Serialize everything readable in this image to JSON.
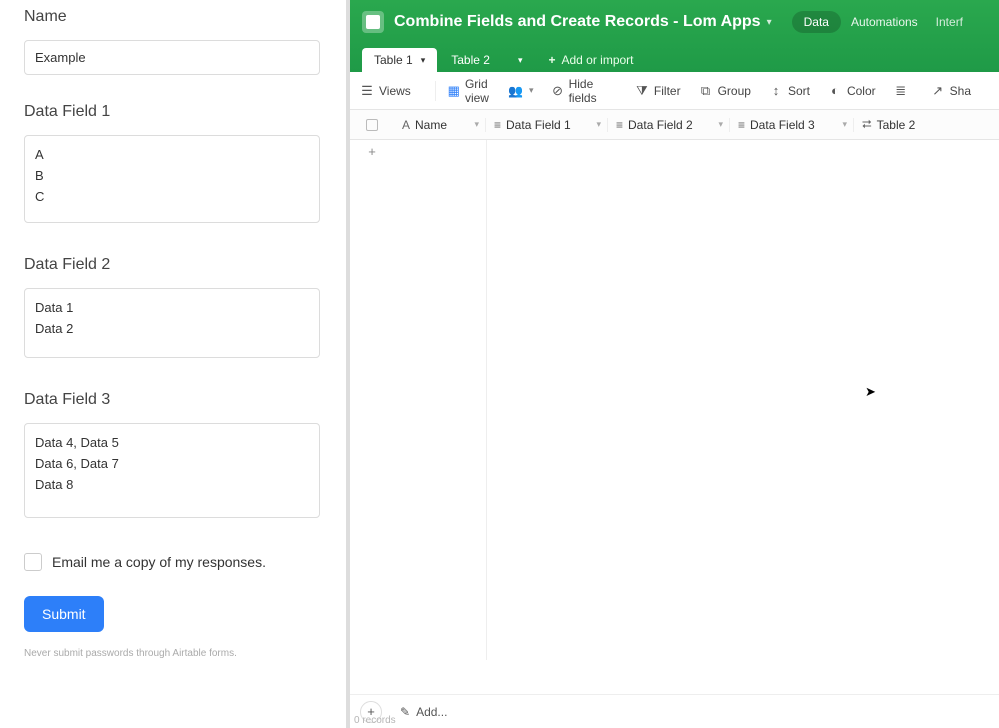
{
  "form": {
    "name_label": "Name",
    "name_value": "Example",
    "field1_label": "Data Field 1",
    "field1_value": "A\nB\nC",
    "field2_label": "Data Field 2",
    "field2_value": "Data 1\nData 2",
    "field3_label": "Data Field 3",
    "field3_value": "Data 4, Data 5\nData 6, Data 7\nData 8",
    "email_me_label": "Email me a copy of my responses.",
    "submit_label": "Submit",
    "disclaimer": "Never submit passwords through Airtable forms."
  },
  "airtable": {
    "title": "Combine Fields and Create Records - Lom Apps",
    "nav": {
      "data": "Data",
      "automations": "Automations",
      "interfaces": "Interf"
    },
    "tabs": {
      "t1": "Table 1",
      "t2": "Table 2",
      "add": "Add or import"
    },
    "toolbar": {
      "views": "Views",
      "grid_view": "Grid view",
      "hide_fields": "Hide fields",
      "filter": "Filter",
      "group": "Group",
      "sort": "Sort",
      "color": "Color",
      "share": "Sha"
    },
    "columns": {
      "name": "Name",
      "d1": "Data Field 1",
      "d2": "Data Field 2",
      "d3": "Data Field 3",
      "t2": "Table 2"
    },
    "bottom": {
      "add": "Add...",
      "records": "0 records"
    }
  }
}
